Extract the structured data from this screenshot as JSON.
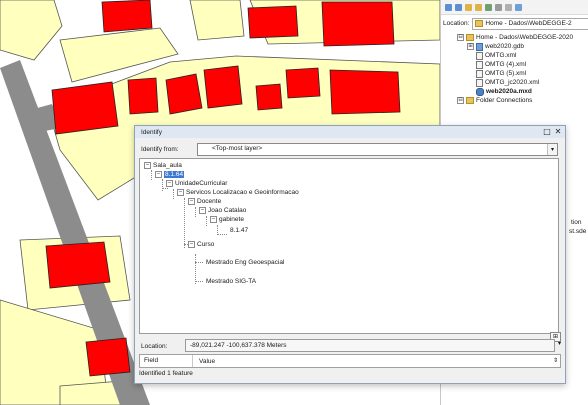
{
  "catalog": {
    "location_label": "Location:",
    "location_value": "Home - Dados\\WebDEGGE-2",
    "items": [
      {
        "label": "Home - Dados\\WebDEGGE-2020",
        "icon": "home-folder-icon",
        "expander": "⊟",
        "bold": false
      },
      {
        "label": "web2020.gdb",
        "icon": "geodatabase-icon",
        "expander": "⊞",
        "bold": false
      },
      {
        "label": "OMTG.xml",
        "icon": "xml-file-icon",
        "expander": "",
        "bold": false
      },
      {
        "label": "OMTG (4).xml",
        "icon": "xml-file-icon",
        "expander": "",
        "bold": false
      },
      {
        "label": "OMTG (5).xml",
        "icon": "xml-file-icon",
        "expander": "",
        "bold": false
      },
      {
        "label": "OMTG_jc2020.xml",
        "icon": "xml-file-icon",
        "expander": "",
        "bold": false
      },
      {
        "label": "web2020a.mxd",
        "icon": "map-document-icon",
        "expander": "",
        "bold": true
      },
      {
        "label": "Folder Connections",
        "icon": "folder-icon",
        "expander": "⊟",
        "bold": false
      }
    ],
    "side_fragments": [
      "tion",
      "st.sde"
    ]
  },
  "identify": {
    "title": "Identify",
    "from_label": "Identify from:",
    "from_value": "<Top-most layer>",
    "tree": {
      "layer": "Sala_aula",
      "feature": "8.1.64",
      "n1": "UnidadeCurricular",
      "n2": "Servicos Localizacao e Geoinformacao",
      "n3": "Docente",
      "n4": "Joao Catalao",
      "n5": "gabinete",
      "n6": "8.1.47",
      "n7": "Curso",
      "n8": "Mestrado Eng Geoespacial",
      "n9": "Mestrado SIG-TA"
    },
    "location_label": "Location:",
    "location_value": "-89,021.247  -100,637.378 Meters",
    "columns": [
      "Field",
      "Value"
    ],
    "status": "Identified 1 feature"
  },
  "colors": {
    "building": "#ff0000",
    "parcel": "#ffffbe",
    "road": "#8c8c8c",
    "selection": "#3d79d0"
  }
}
